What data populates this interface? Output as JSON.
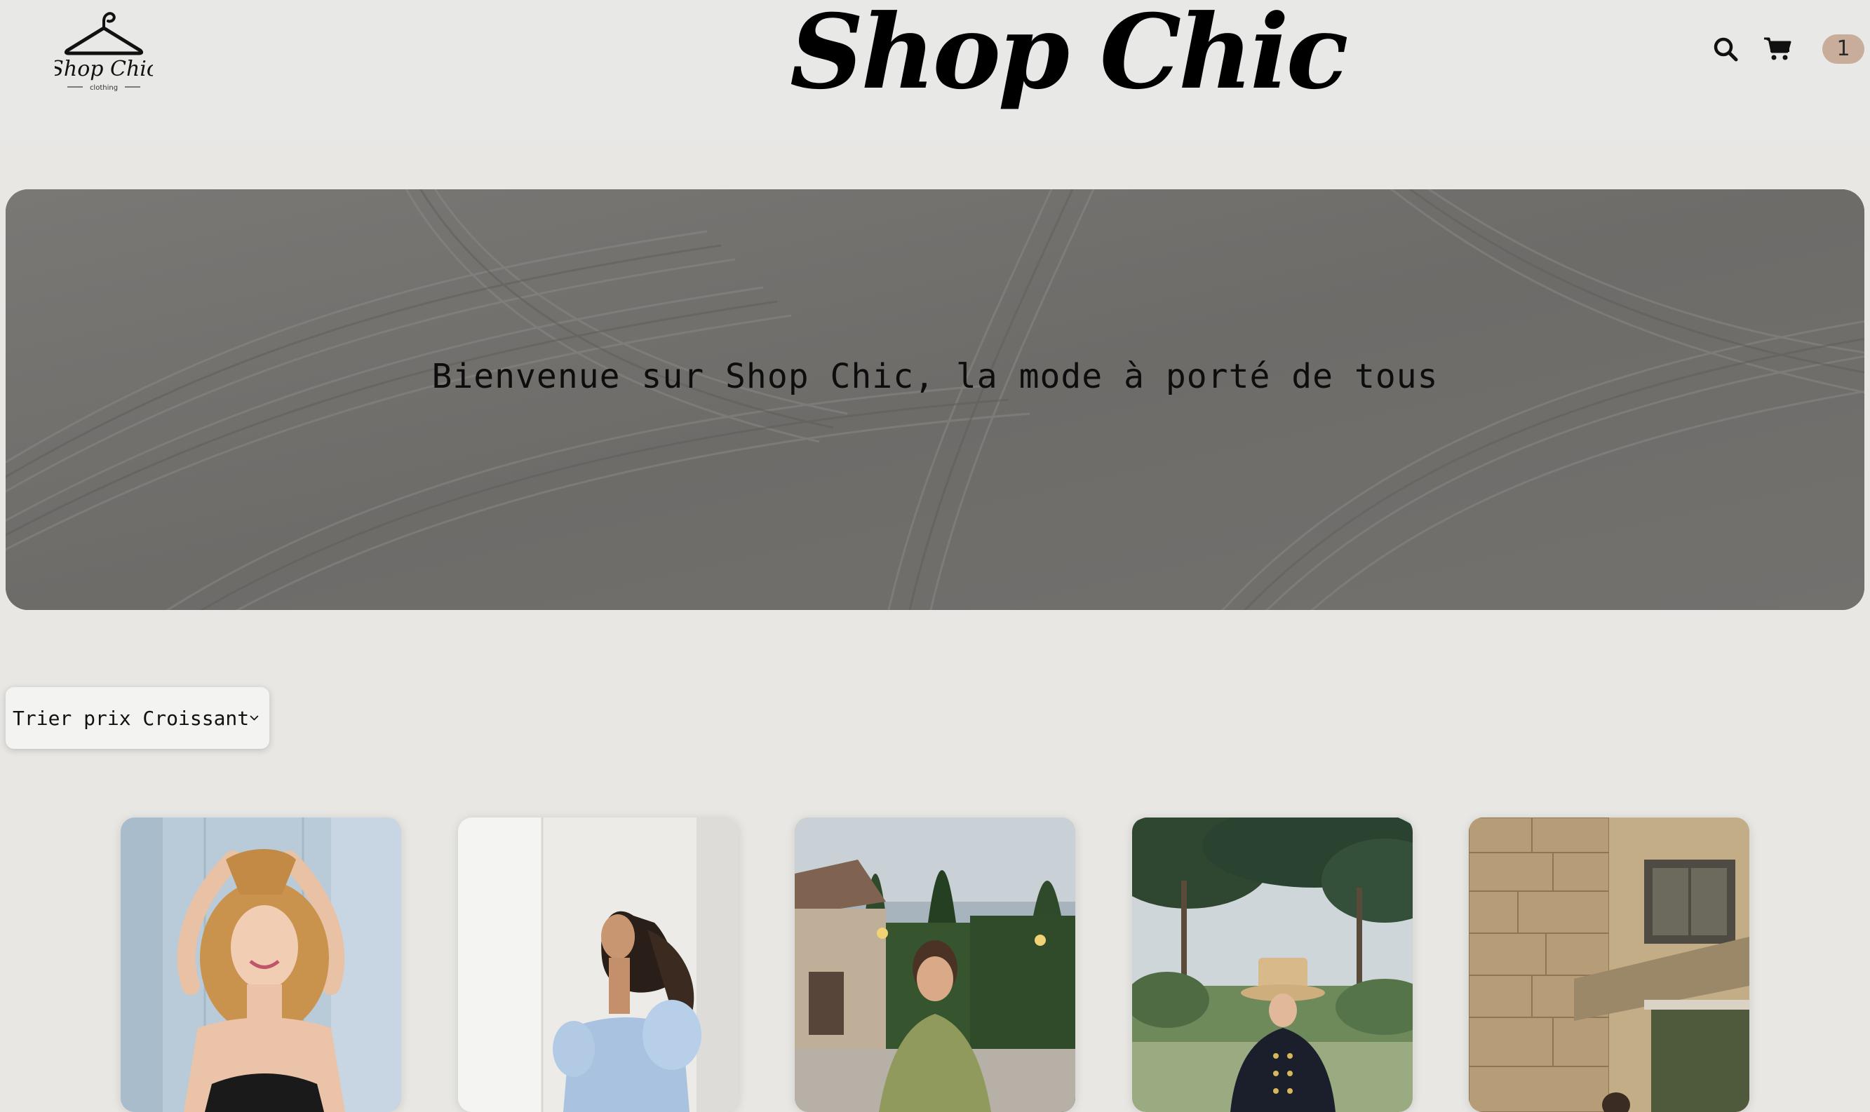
{
  "header": {
    "logo_text": "Shop Chic",
    "logo_subtext": "clothing",
    "title": "Shop Chic",
    "cart_count": "1"
  },
  "hero": {
    "text": "Bienvenue sur Shop Chic, la mode à porté de tous"
  },
  "sort": {
    "selected": "Trier prix Croissant"
  },
  "products": [
    {
      "alt": "product-1"
    },
    {
      "alt": "product-2"
    },
    {
      "alt": "product-3"
    },
    {
      "alt": "product-4"
    },
    {
      "alt": "product-5"
    }
  ],
  "colors": {
    "page_bg": "#e8e7e3",
    "badge_bg": "#c8ad9a",
    "hero_bg": "#6f6d6a"
  },
  "icons": [
    "hanger-icon",
    "search-icon",
    "cart-icon",
    "chevron-down-icon"
  ]
}
